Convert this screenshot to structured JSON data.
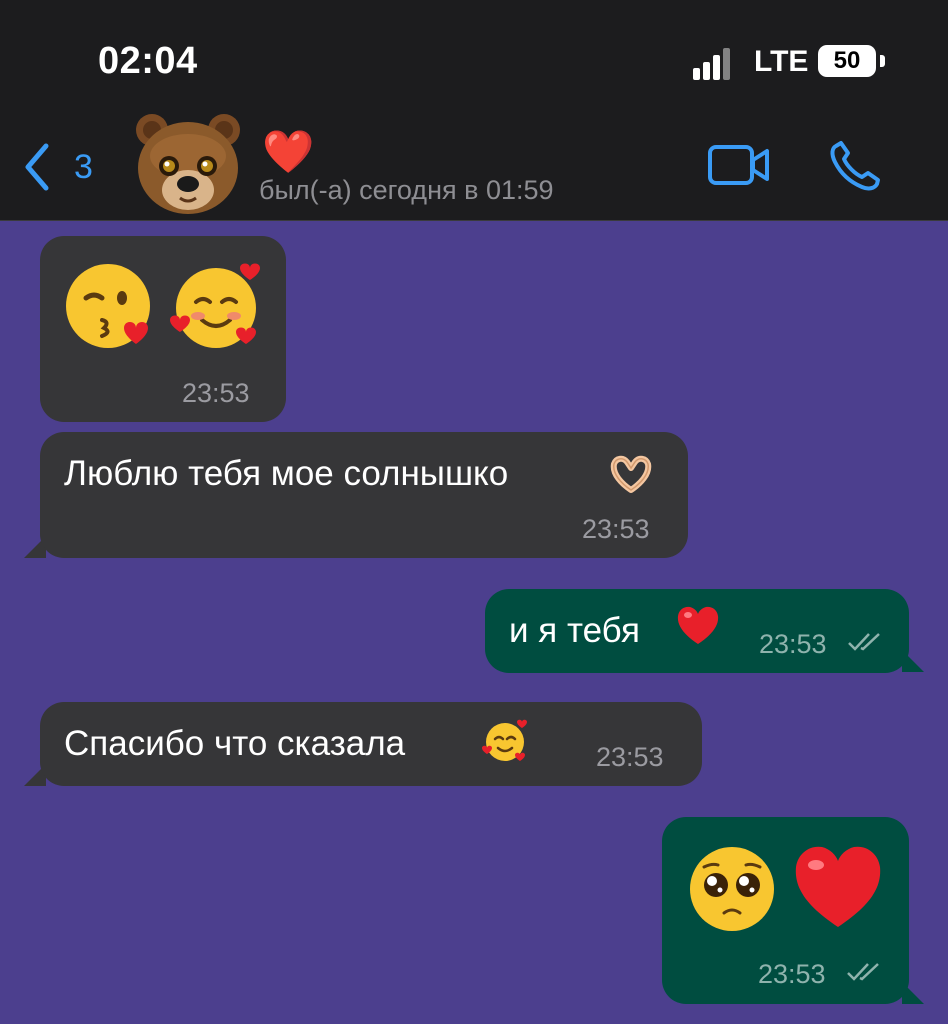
{
  "status_bar": {
    "time": "02:04",
    "network": "LTE",
    "battery": "50"
  },
  "header": {
    "back_count": "3",
    "contact_name": "❤️",
    "last_seen": "был(-а) сегодня в 01:59",
    "icons": [
      "chevron-left-icon",
      "bear-avatar",
      "video-call-icon",
      "phone-icon"
    ]
  },
  "colors": {
    "chat_background": "#4c3f8e",
    "incoming_bubble": "#363638",
    "outgoing_bubble": "#004d40",
    "accent": "#3a9bf5",
    "heart": "#ff2d3b"
  },
  "messages": [
    {
      "direction": "incoming",
      "text": "",
      "emojis": [
        "face-blowing-kiss",
        "smiling-face-with-hearts"
      ],
      "time": "23:53"
    },
    {
      "direction": "incoming",
      "text": "Люблю тебя мое солнышко",
      "emojis": [
        "heart-hands"
      ],
      "time": "23:53"
    },
    {
      "direction": "outgoing",
      "text": "и я тебя",
      "emojis": [
        "red-heart"
      ],
      "time": "23:53",
      "read": true
    },
    {
      "direction": "incoming",
      "text": "Спасибо что сказала",
      "emojis": [
        "smiling-face-with-hearts"
      ],
      "time": "23:53"
    },
    {
      "direction": "outgoing",
      "text": "",
      "emojis": [
        "pleading-face",
        "red-heart"
      ],
      "time": "23:53",
      "read": true
    }
  ]
}
